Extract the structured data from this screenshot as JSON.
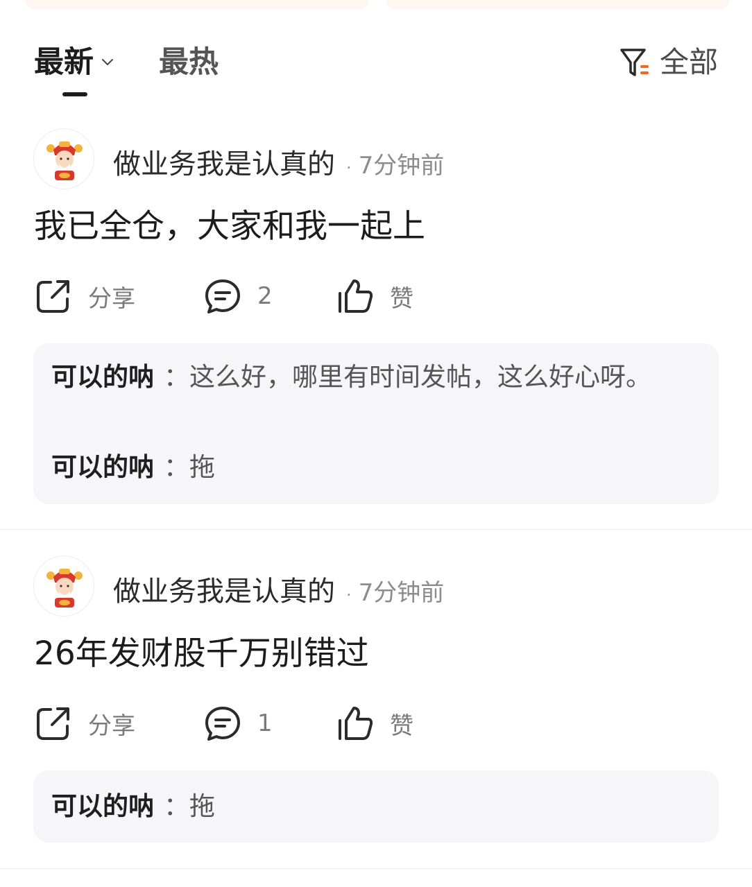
{
  "tabs": {
    "latest": "最新",
    "hot": "最热",
    "filter_label": "全部"
  },
  "posts": [
    {
      "author": "做业务我是认真的",
      "separator": "·",
      "time": "7分钟前",
      "body": "我已全仓，大家和我一起上",
      "actions": {
        "share": "分享",
        "comments": "2",
        "like": "赞"
      },
      "replies": [
        {
          "user": "可以的呐",
          "text": "：这么好，哪里有时间发帖，这么好心呀。"
        },
        {
          "user": "可以的呐",
          "text": "：拖"
        }
      ]
    },
    {
      "author": "做业务我是认真的",
      "separator": "·",
      "time": "7分钟前",
      "body": "26年发财股千万别错过",
      "actions": {
        "share": "分享",
        "comments": "1",
        "like": "赞"
      },
      "replies": [
        {
          "user": "可以的呐",
          "text": "：拖"
        }
      ]
    }
  ],
  "colors": {
    "accent": "#f06a1d",
    "reply_bg": "#f6f6f8",
    "text_primary": "#1c1c1c",
    "text_secondary": "#8c8c8c"
  },
  "icons": [
    "chevron-down-icon",
    "filter-icon",
    "share-icon",
    "comment-icon",
    "thumbs-up-icon",
    "avatar-caishen-icon"
  ]
}
